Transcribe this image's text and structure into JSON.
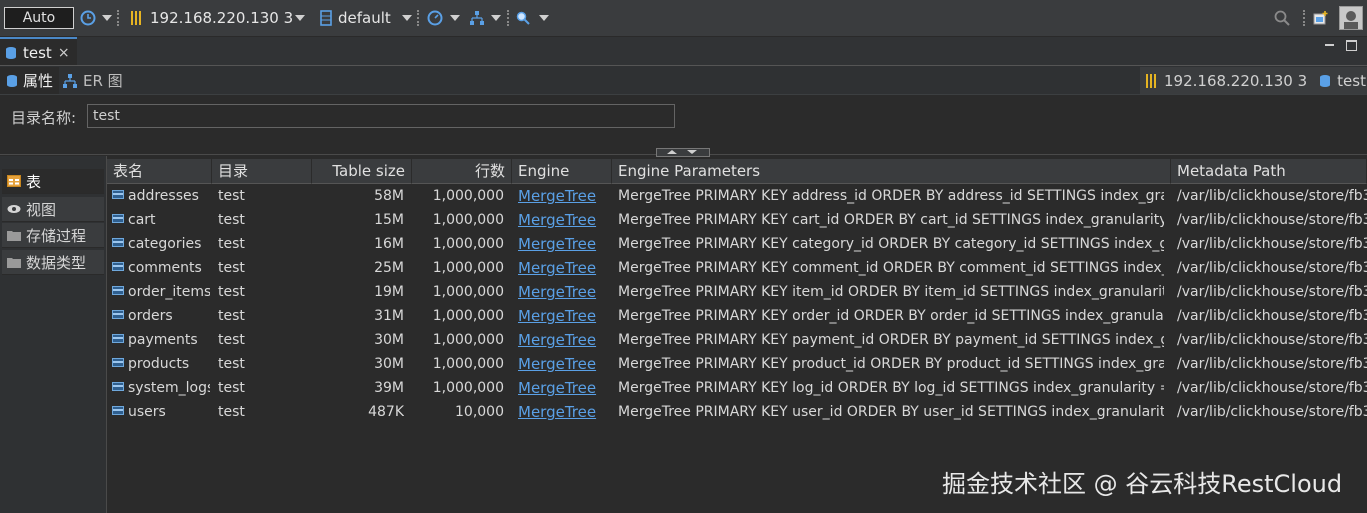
{
  "toolbar": {
    "mode": "Auto",
    "connection": "192.168.220.130 3",
    "database": "default"
  },
  "editor_tab": {
    "label": "test",
    "close": "×"
  },
  "sub_tabs": [
    {
      "label": "属性"
    },
    {
      "label": "ER 图"
    }
  ],
  "context": {
    "connection": "192.168.220.130 3",
    "catalog": "test"
  },
  "form": {
    "label": "目录名称:",
    "value": "test"
  },
  "nav": [
    {
      "label": "表"
    },
    {
      "label": "视图"
    },
    {
      "label": "存储过程"
    },
    {
      "label": "数据类型"
    }
  ],
  "table": {
    "headers": [
      "表名",
      "目录",
      "Table size",
      "行数",
      "Engine",
      "Engine Parameters",
      "Metadata Path"
    ],
    "rows": [
      [
        "addresses",
        "test",
        "58M",
        "1,000,000",
        "MergeTree",
        "MergeTree PRIMARY KEY address_id ORDER BY address_id SETTINGS index_gran...",
        "/var/lib/clickhouse/store/fb3"
      ],
      [
        "cart",
        "test",
        "15M",
        "1,000,000",
        "MergeTree",
        "MergeTree PRIMARY KEY cart_id ORDER BY cart_id SETTINGS index_granularity =...",
        "/var/lib/clickhouse/store/fb3"
      ],
      [
        "categories",
        "test",
        "16M",
        "1,000,000",
        "MergeTree",
        "MergeTree PRIMARY KEY category_id ORDER BY category_id SETTINGS index_gr...",
        "/var/lib/clickhouse/store/fb3"
      ],
      [
        "comments",
        "test",
        "25M",
        "1,000,000",
        "MergeTree",
        "MergeTree PRIMARY KEY comment_id ORDER BY comment_id SETTINGS index_g...",
        "/var/lib/clickhouse/store/fb3"
      ],
      [
        "order_items",
        "test",
        "19M",
        "1,000,000",
        "MergeTree",
        "MergeTree PRIMARY KEY item_id ORDER BY item_id SETTINGS index_granularity ...",
        "/var/lib/clickhouse/store/fb3"
      ],
      [
        "orders",
        "test",
        "31M",
        "1,000,000",
        "MergeTree",
        "MergeTree PRIMARY KEY order_id ORDER BY order_id SETTINGS index_granularit...",
        "/var/lib/clickhouse/store/fb3"
      ],
      [
        "payments",
        "test",
        "30M",
        "1,000,000",
        "MergeTree",
        "MergeTree PRIMARY KEY payment_id ORDER BY payment_id SETTINGS index_gr...",
        "/var/lib/clickhouse/store/fb3"
      ],
      [
        "products",
        "test",
        "30M",
        "1,000,000",
        "MergeTree",
        "MergeTree PRIMARY KEY product_id ORDER BY product_id SETTINGS index_gran...",
        "/var/lib/clickhouse/store/fb3"
      ],
      [
        "system_logs",
        "test",
        "39M",
        "1,000,000",
        "MergeTree",
        "MergeTree PRIMARY KEY log_id ORDER BY log_id SETTINGS index_granularity = ...",
        "/var/lib/clickhouse/store/fb3"
      ],
      [
        "users",
        "test",
        "487K",
        "10,000",
        "MergeTree",
        "MergeTree PRIMARY KEY user_id ORDER BY user_id SETTINGS index_granularity ...",
        "/var/lib/clickhouse/store/fb3"
      ]
    ]
  },
  "watermark": "掘金技术社区 @ 谷云科技RestCloud"
}
